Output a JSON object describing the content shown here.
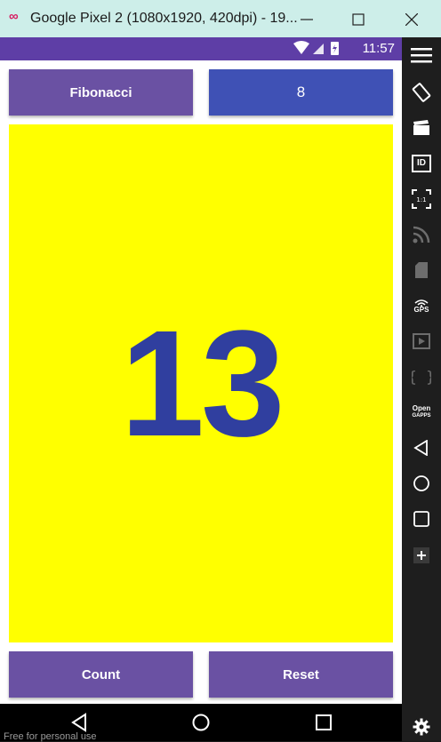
{
  "window": {
    "title": "Google Pixel 2 (1080x1920, 420dpi) - 19...",
    "logo": "∞"
  },
  "statusbar": {
    "time": "11:57"
  },
  "app": {
    "mode_button": "Fibonacci",
    "input_value": "8",
    "result": "13",
    "count_button": "Count",
    "reset_button": "Reset"
  },
  "nav": {
    "back": "back-icon",
    "home": "home-icon",
    "recents": "recents-icon"
  },
  "watermark": "Free for personal use",
  "toolbar": {
    "gps_label": "GPS",
    "opengapps_label_1": "Open",
    "opengapps_label_2": "GAPPS",
    "id_label": "ID",
    "ratio_label": "1:1"
  },
  "colors": {
    "primary": "#6a51a3",
    "accent": "#3f51b5",
    "display_bg": "#ffff00",
    "number": "#303f9f"
  }
}
